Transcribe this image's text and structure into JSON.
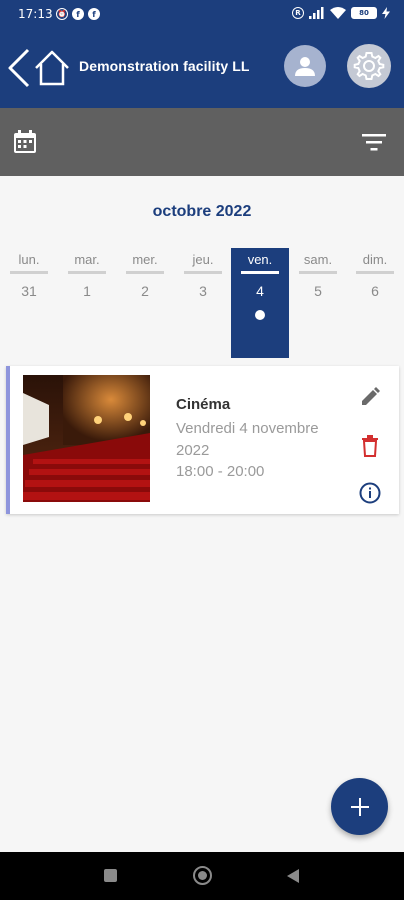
{
  "status_bar": {
    "time": "17:13",
    "battery": "80"
  },
  "app_bar": {
    "title": "Demonstration facility LL"
  },
  "calendar": {
    "month": "octobre 2022",
    "days": [
      {
        "name": "lun.",
        "num": "31"
      },
      {
        "name": "mar.",
        "num": "1"
      },
      {
        "name": "mer.",
        "num": "2"
      },
      {
        "name": "jeu.",
        "num": "3"
      },
      {
        "name": "ven.",
        "num": "4"
      },
      {
        "name": "sam.",
        "num": "5"
      },
      {
        "name": "dim.",
        "num": "6"
      }
    ],
    "selected_index": 4
  },
  "event": {
    "title": "Cinéma",
    "date": "Vendredi 4 novembre 2022",
    "time": "18:00 - 20:00"
  },
  "colors": {
    "primary": "#1c3e7d",
    "toolbar": "#606060",
    "delete": "#d32f2f",
    "accent_border": "#8e95dc"
  },
  "icons": {
    "back": "chevron-left-icon",
    "home": "home-icon",
    "user": "person-icon",
    "settings": "gear-icon",
    "calendar": "calendar-icon",
    "filter": "filter-icon",
    "edit": "pencil-icon",
    "delete": "trash-icon",
    "info": "info-icon",
    "add": "plus-icon"
  }
}
